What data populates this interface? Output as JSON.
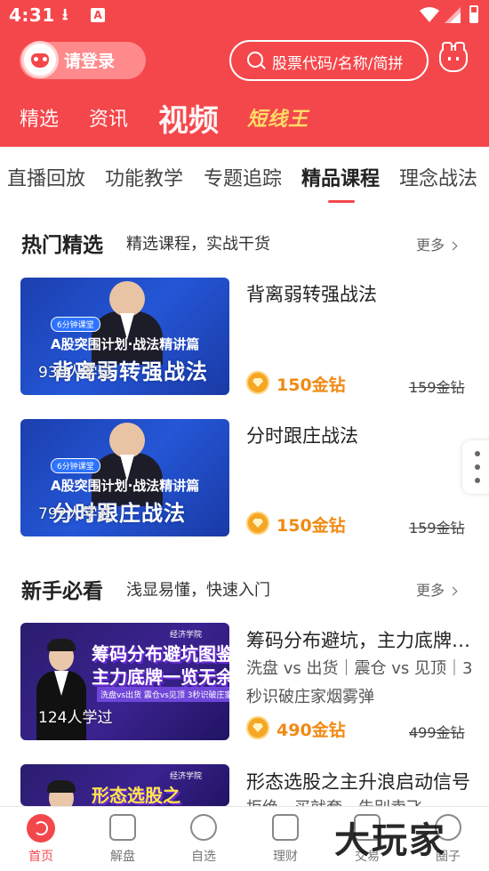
{
  "status": {
    "time": "4:31"
  },
  "header": {
    "login_label": "请登录",
    "search_placeholder": "股票代码/名称/简拼",
    "tabs": [
      "精选",
      "资讯",
      "视频",
      "短线王"
    ]
  },
  "category_tabs": [
    "直播回放",
    "功能教学",
    "专题追踪",
    "精品课程",
    "理念战法"
  ],
  "active_category": "精品课程",
  "sections": [
    {
      "title": "热门精选",
      "subtitle": "精选课程，实战干货",
      "more": "更多",
      "courses": [
        {
          "title": "背离弱转强战法",
          "thumb_badge": "6分钟课堂",
          "thumb_subtitle": "A股突围计划·战法精讲篇",
          "thumb_title": "背离弱转强战法",
          "learners": "930人学过",
          "price": "150金钻",
          "orig_price": "159金钻"
        },
        {
          "title": "分时跟庄战法",
          "thumb_badge": "6分钟课堂",
          "thumb_subtitle": "A股突围计划·战法精讲篇",
          "thumb_title": "分时跟庄战法",
          "learners": "792人学过",
          "price": "150金钻",
          "orig_price": "159金钻"
        }
      ]
    },
    {
      "title": "新手必看",
      "subtitle": "浅显易懂，快速入门",
      "more": "更多",
      "courses": [
        {
          "title": "筹码分布避坑，主力底牌一览无余",
          "desc": "洗盘 vs 出货｜震仓 vs 见顶｜3秒识破庄家烟雾弹",
          "thumb_logo": "经济学院",
          "thumb_title_1": "筹码分布避坑图鉴",
          "thumb_title_2": "主力底牌一览无余",
          "thumb_tag": "洗盘vs出货  震仓vs见顶  3秒识破庄家烟雾弹",
          "learners": "124人学过",
          "price": "490金钻",
          "orig_price": "499金钻"
        },
        {
          "title": "形态选股之主升浪启动信号",
          "desc": "拒绝一买就套，告别卖飞",
          "thumb_logo": "经济学院",
          "thumb_title_1": "形态选股之"
        }
      ]
    }
  ],
  "bottom_nav": [
    "首页",
    "解盘",
    "自选",
    "理财",
    "交易",
    "圈子"
  ],
  "watermark": "大玩家",
  "colors": {
    "brand": "#f4474b",
    "price": "#f08a14",
    "gold": "#ffe46a"
  }
}
